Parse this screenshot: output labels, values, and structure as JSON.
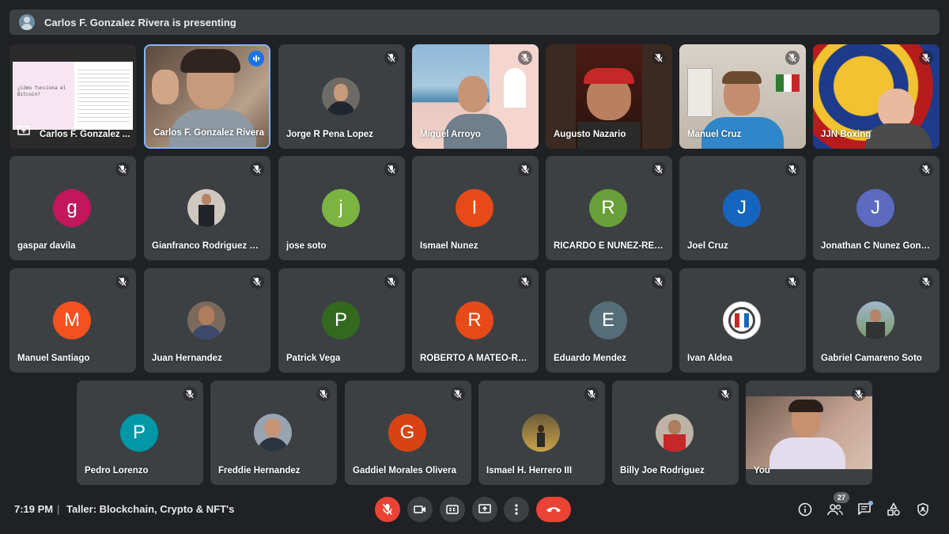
{
  "banner": {
    "text": "Carlos F. Gonzalez Rivera is presenting"
  },
  "presentation": {
    "name": "Carlos F. Gonzalez ...",
    "slide_title": "¿Cómo funciona el Bitcoin?"
  },
  "participants": [
    {
      "name": "Carlos F. Gonzalez Rivera",
      "kind": "video",
      "speaking": true
    },
    {
      "name": "Jorge R Pena Lopez",
      "kind": "photo"
    },
    {
      "name": "Miguel Arroyo",
      "kind": "video"
    },
    {
      "name": "Augusto Nazario",
      "kind": "video"
    },
    {
      "name": "Manuel Cruz",
      "kind": "video"
    },
    {
      "name": "JJN Boxing",
      "kind": "video"
    },
    {
      "name": "gaspar davila",
      "kind": "letter",
      "letter": "g",
      "color": "#c2185b"
    },
    {
      "name": "Gianfranco Rodriguez To...",
      "kind": "photo"
    },
    {
      "name": "jose soto",
      "kind": "letter",
      "letter": "j",
      "color": "#7cb342"
    },
    {
      "name": "Ismael Nunez",
      "kind": "letter",
      "letter": "I",
      "color": "#e64a19"
    },
    {
      "name": "RICARDO E NUNEZ-REYES",
      "kind": "letter",
      "letter": "R",
      "color": "#689f38"
    },
    {
      "name": "Joel Cruz",
      "kind": "letter",
      "letter": "J",
      "color": "#1565c0"
    },
    {
      "name": "Jonathan C Nunez Gonza...",
      "kind": "letter",
      "letter": "J",
      "color": "#5c6bc0"
    },
    {
      "name": "Manuel Santiago",
      "kind": "letter",
      "letter": "M",
      "color": "#f4511e"
    },
    {
      "name": "Juan Hernandez",
      "kind": "photo"
    },
    {
      "name": "Patrick Vega",
      "kind": "letter",
      "letter": "P",
      "color": "#33691e"
    },
    {
      "name": "ROBERTO A MATEO-REYES",
      "kind": "letter",
      "letter": "R",
      "color": "#e64a19"
    },
    {
      "name": "Eduardo Mendez",
      "kind": "letter",
      "letter": "E",
      "color": "#546e7a"
    },
    {
      "name": "Ivan Aldea",
      "kind": "photo"
    },
    {
      "name": "Gabriel Camareno Soto",
      "kind": "photo"
    },
    {
      "name": "Pedro Lorenzo",
      "kind": "letter",
      "letter": "P",
      "color": "#0097a7"
    },
    {
      "name": "Freddie Hernandez",
      "kind": "photo"
    },
    {
      "name": "Gaddiel Morales Olivera",
      "kind": "letter",
      "letter": "G",
      "color": "#d84315"
    },
    {
      "name": "Ismael H. Herrero III",
      "kind": "photo"
    },
    {
      "name": "Billy Joe Rodriguez",
      "kind": "photo"
    },
    {
      "name": "You",
      "kind": "video"
    }
  ],
  "bottom": {
    "time": "7:19 PM",
    "separator": "|",
    "meeting_title": "Taller: Blockchain, Crypto & NFT's",
    "people_count": "27"
  },
  "colors": {
    "background": "#202124",
    "tile": "#3c4043",
    "accent": "#8ab4f8",
    "danger": "#ea4335"
  },
  "icons": [
    "mic-off-icon",
    "camera-icon",
    "captions-icon",
    "present-icon",
    "more-icon",
    "hangup-icon",
    "info-icon",
    "people-icon",
    "chat-icon",
    "activities-icon",
    "host-controls-icon",
    "present-screen-icon",
    "speaking-icon"
  ]
}
